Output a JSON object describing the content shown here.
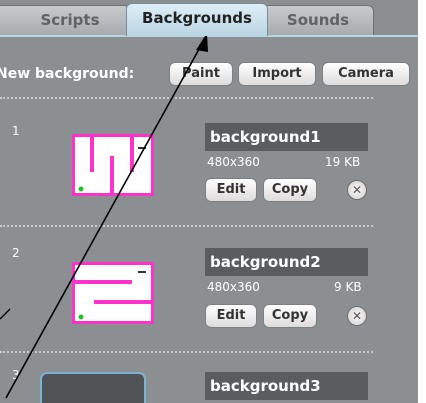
{
  "tabs": [
    {
      "label": "Scripts"
    },
    {
      "label": "Backgrounds"
    },
    {
      "label": "Sounds"
    }
  ],
  "toolbar": {
    "new_background_label": "New background:",
    "paint_label": "Paint",
    "import_label": "Import",
    "camera_label": "Camera"
  },
  "backgrounds": [
    {
      "index": "1",
      "name": "background1",
      "dims": "480x360",
      "size": "19 KB",
      "edit_label": "Edit",
      "copy_label": "Copy",
      "delete_glyph": "✕"
    },
    {
      "index": "2",
      "name": "background2",
      "dims": "480x360",
      "size": "9 KB",
      "edit_label": "Edit",
      "copy_label": "Copy",
      "delete_glyph": "✕"
    },
    {
      "index": "3",
      "name": "background3"
    }
  ],
  "colors": {
    "panel": "#8b8f92",
    "active_tab": "#b9d5e3",
    "thumb_border": "#ff33cc",
    "arrow": "#000000"
  }
}
